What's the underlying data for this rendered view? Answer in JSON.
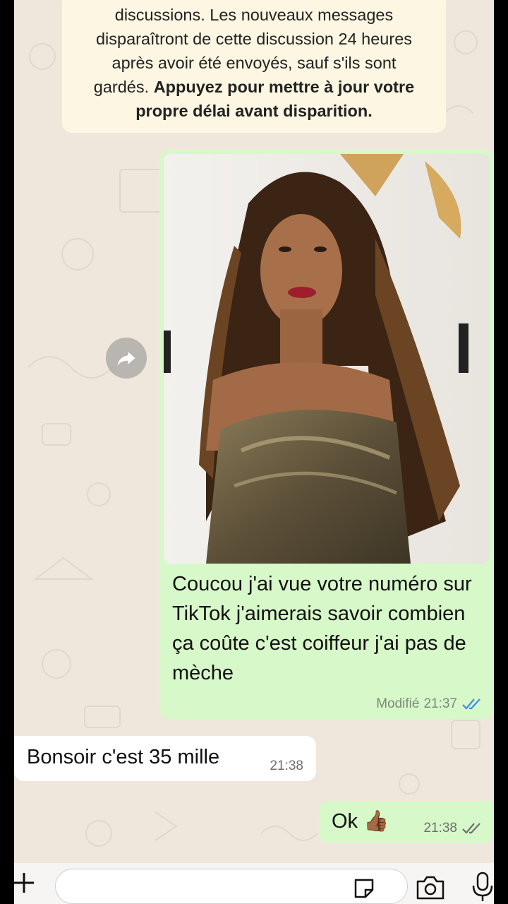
{
  "notice": {
    "line1": "discussions. Les nouveaux messages",
    "line2": "disparaîtront de cette discussion 24 heures",
    "line3": "après avoir été envoyés, sauf s'ils sont",
    "line4_plain": "gardés. ",
    "line4_bold": "Appuyez pour mettre à jour votre",
    "line5_bold": "propre délai avant disparition."
  },
  "messages": {
    "outgoing_image": {
      "caption": "Coucou j'ai vue votre numéro sur TikTok j'aimerais savoir combien ça coûte c'est coiffeur j'ai pas de mèche",
      "edited_label": "Modifié",
      "time": "21:37",
      "status": "read"
    },
    "incoming": {
      "text": "Bonsoir c'est 35 mille",
      "time": "21:38"
    },
    "outgoing_short": {
      "text": "Ok",
      "emoji": "👍🏾",
      "time": "21:38",
      "status": "delivered"
    }
  },
  "input": {
    "placeholder": ""
  },
  "colors": {
    "outgoing_bubble": "#d7f8c9",
    "incoming_bubble": "#ffffff",
    "read_ticks": "#3a8ee6",
    "chat_background": "#efe7dc"
  },
  "icons": {
    "forward": "forward-icon",
    "plus": "plus-icon",
    "sticker": "sticker-icon",
    "camera": "camera-icon",
    "mic": "microphone-icon",
    "read": "double-check-icon"
  }
}
